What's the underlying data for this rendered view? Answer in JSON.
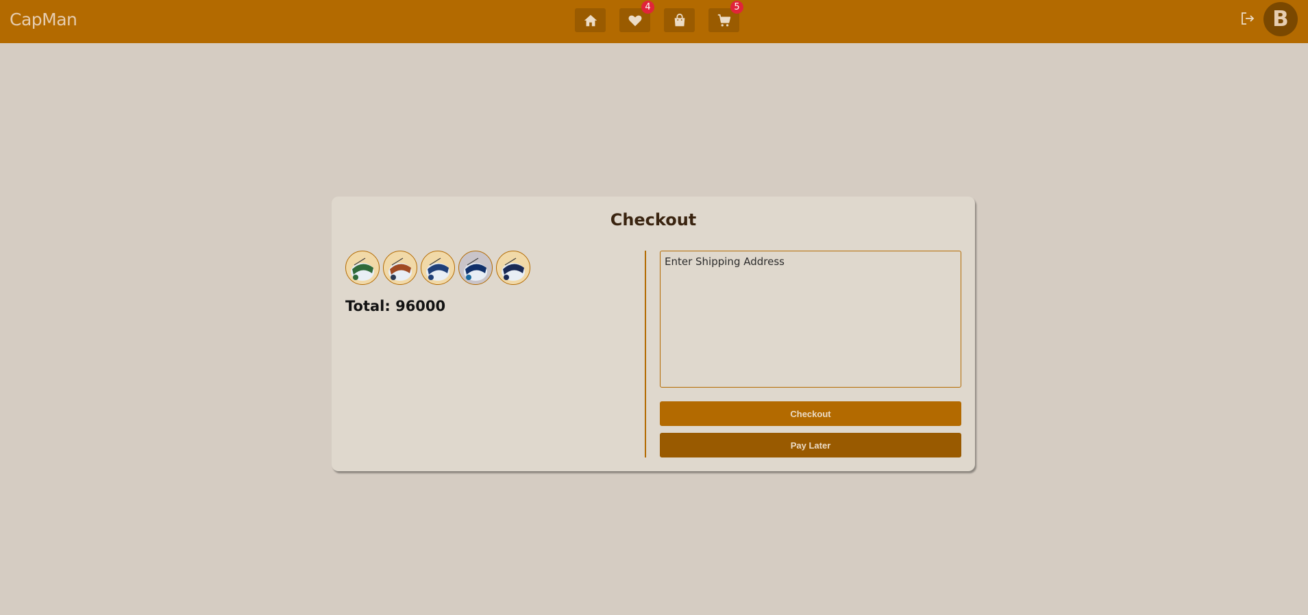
{
  "header": {
    "brand": "CapMan",
    "nav": [
      {
        "name": "home",
        "icon": "home-icon",
        "badge": ""
      },
      {
        "name": "wishlist",
        "icon": "heart-icon",
        "badge": "4"
      },
      {
        "name": "orders",
        "icon": "shopping-bag-icon",
        "badge": ""
      },
      {
        "name": "cart",
        "icon": "cart-icon",
        "badge": "5"
      }
    ],
    "logout_icon": "logout-icon",
    "avatar_letter": "B"
  },
  "checkout": {
    "title": "Checkout",
    "items": [
      {
        "icon": "product-thumbnail",
        "tint": "#2f6a3a"
      },
      {
        "icon": "product-thumbnail",
        "tint": "#a04a22"
      },
      {
        "icon": "product-thumbnail",
        "tint": "#1f3f78"
      },
      {
        "icon": "product-thumbnail",
        "tint": "#0f2f6a"
      },
      {
        "icon": "product-thumbnail",
        "tint": "#1a2a55"
      }
    ],
    "total_text": "Total: 96000",
    "address_placeholder": "Enter Shipping Address",
    "address_value": "",
    "checkout_label": "Checkout",
    "pay_later_label": "Pay Later"
  },
  "colors": {
    "topbar": "#b36a00",
    "background": "#d5ccc2",
    "card": "#dfd8cd",
    "badge": "#e0243a"
  }
}
